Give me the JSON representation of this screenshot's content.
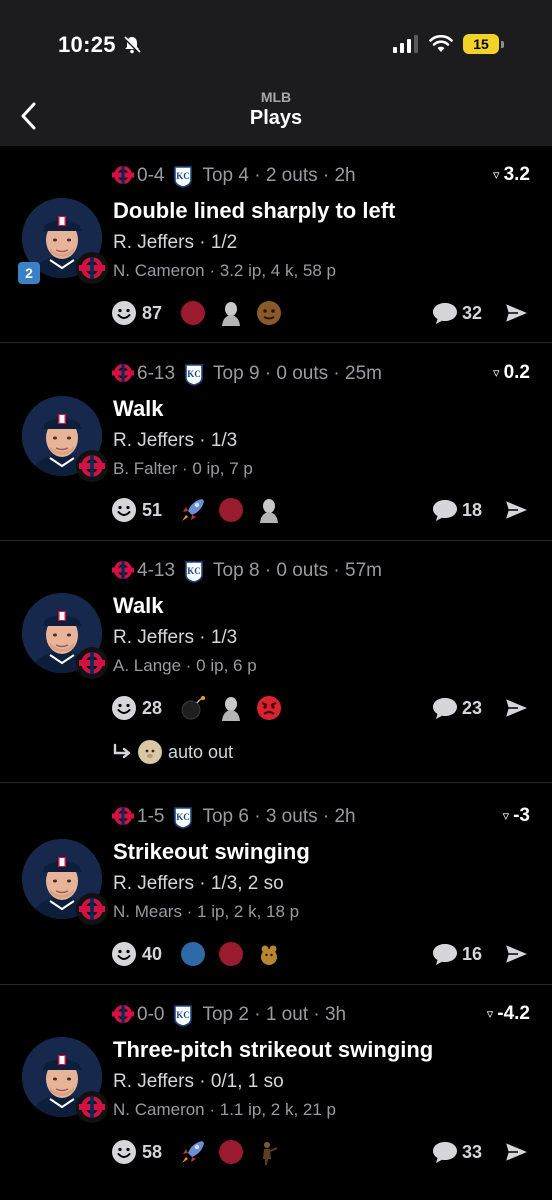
{
  "status": {
    "time": "10:25",
    "battery": "15"
  },
  "nav": {
    "subtitle": "MLB",
    "title": "Plays"
  },
  "plays": [
    {
      "score": "0-4",
      "inning": "Top 4 · 2 outs · 2h",
      "wpa": "3.2",
      "title": "Double lined sharply to left",
      "batter": "R. Jeffers · 1/2",
      "pitcher": "N. Cameron · 3.2 ip, 4 k, 58 p",
      "badge": "2",
      "reactions_count": "87",
      "comments_count": "32",
      "reaction_icons": [
        "red-dot",
        "sculpture-icon",
        "face-icon"
      ]
    },
    {
      "score": "6-13",
      "inning": "Top 9 · 0 outs · 25m",
      "wpa": "0.2",
      "title": "Walk",
      "batter": "R. Jeffers · 1/3",
      "pitcher": "B. Falter · 0 ip, 7 p",
      "reactions_count": "51",
      "comments_count": "18",
      "reaction_icons": [
        "rocket-icon",
        "red-dot",
        "sculpture-icon"
      ]
    },
    {
      "score": "4-13",
      "inning": "Top 8 · 0 outs · 57m",
      "wpa": "",
      "title": "Walk",
      "batter": "R. Jeffers · 1/3",
      "pitcher": "A. Lange · 0 ip, 6 p",
      "reactions_count": "28",
      "comments_count": "23",
      "reaction_icons": [
        "bomb-icon",
        "sculpture-icon",
        "angry-face-icon"
      ],
      "auto_label": "auto out"
    },
    {
      "score": "1-5",
      "inning": "Top 6 · 3 outs · 2h",
      "wpa": "-3",
      "title": "Strikeout swinging",
      "batter": "R. Jeffers · 1/3, 2 so",
      "pitcher": "N. Mears · 1 ip, 2 k, 18 p",
      "reactions_count": "40",
      "comments_count": "16",
      "reaction_icons": [
        "blue-dot",
        "red-dot",
        "rodent-icon"
      ]
    },
    {
      "score": "0-0",
      "inning": "Top 2 · 1 out · 3h",
      "wpa": "-4.2",
      "title": "Three-pitch strikeout swinging",
      "batter": "R. Jeffers · 0/1, 1 so",
      "pitcher": "N. Cameron · 1.1 ip, 2 k, 21 p",
      "reactions_count": "58",
      "comments_count": "33",
      "reaction_icons": [
        "rocket-icon",
        "red-dot",
        "figure-icon"
      ]
    }
  ],
  "colors": {
    "twins_red": "#d31145",
    "twins_navy": "#002b5c",
    "royals_blue": "#174885",
    "dot_red": "#9a1a2e",
    "dot_blue": "#2e6aa8"
  }
}
